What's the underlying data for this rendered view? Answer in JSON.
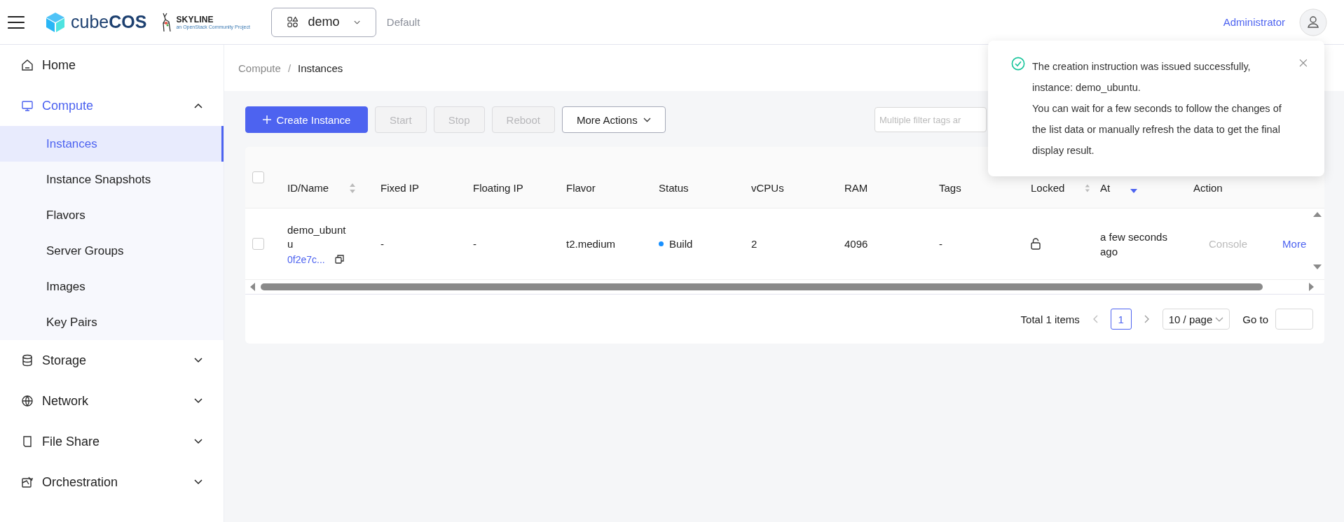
{
  "topbar": {
    "brand_light": "cube",
    "brand_bold": "COS",
    "partner": "SKYLINE",
    "partner_tagline": "an OpenStack Community Project",
    "project": "demo",
    "domain": "Default",
    "user": "Administrator"
  },
  "sidebar": {
    "items": [
      {
        "label": "Home",
        "selected": false
      },
      {
        "label": "Compute",
        "selected": true,
        "expanded": true,
        "children": [
          {
            "label": "Instances",
            "selected": true
          },
          {
            "label": "Instance Snapshots",
            "selected": false
          },
          {
            "label": "Flavors",
            "selected": false
          },
          {
            "label": "Server Groups",
            "selected": false
          },
          {
            "label": "Images",
            "selected": false
          },
          {
            "label": "Key Pairs",
            "selected": false
          }
        ]
      },
      {
        "label": "Storage",
        "selected": false,
        "expanded": false
      },
      {
        "label": "Network",
        "selected": false,
        "expanded": false
      },
      {
        "label": "File Share",
        "selected": false,
        "expanded": false
      },
      {
        "label": "Orchestration",
        "selected": false,
        "expanded": false
      }
    ]
  },
  "breadcrumb": {
    "items": [
      "Compute",
      "Instances"
    ],
    "separator": "/"
  },
  "toolbar": {
    "buttons": [
      {
        "label": "Create Instance",
        "kind": "primary",
        "disabled": false
      },
      {
        "label": "Start",
        "kind": "plain",
        "disabled": true
      },
      {
        "label": "Stop",
        "kind": "plain",
        "disabled": true
      },
      {
        "label": "Reboot",
        "kind": "plain",
        "disabled": true
      },
      {
        "label": "More Actions",
        "kind": "dropdown",
        "disabled": false
      }
    ],
    "filter": {
      "placeholder": "Multiple filter tags ar"
    }
  },
  "table": {
    "all_checked": false,
    "columns": [
      {
        "label": "ID/Name",
        "sortable": true,
        "sorted": false
      },
      {
        "label": "Fixed IP",
        "sortable": false
      },
      {
        "label": "Floating IP",
        "sortable": false
      },
      {
        "label": "Flavor",
        "sortable": false
      },
      {
        "label": "Status",
        "sortable": false
      },
      {
        "label": "vCPUs",
        "sortable": false
      },
      {
        "label": "RAM",
        "sortable": false
      },
      {
        "label": "Tags",
        "sortable": false
      },
      {
        "label": "Locked",
        "sortable": true,
        "sorted": false
      },
      {
        "label": "At",
        "sortable": true,
        "sorted": true
      },
      {
        "label": "Action",
        "sortable": false
      }
    ],
    "rows": [
      {
        "checked": false,
        "name": "demo_ubuntu",
        "id": "0f2e7c...",
        "fixed_ip": "-",
        "floating_ip": "-",
        "flavor": "t2.medium",
        "status": {
          "label": "Build",
          "color": "#1890ff"
        },
        "vcpus": "2",
        "ram": "4096",
        "tags": "-",
        "locked": false,
        "created": "a few seconds ago",
        "actions": [
          {
            "label": "Console",
            "disabled": true
          },
          {
            "label": "More",
            "disabled": false
          }
        ]
      }
    ]
  },
  "pagination": {
    "total": "Total 1 items",
    "pages": [
      {
        "label": "1",
        "selected": true
      }
    ],
    "page_size": "10 / page",
    "goto": "Go to"
  },
  "toast": {
    "kind": "success",
    "message": "The creation instruction was issued successfully, instance: demo_ubuntu.",
    "detail": "You can wait for a few seconds to follow the changes of the list data or manually refresh the data to get the final display result."
  }
}
